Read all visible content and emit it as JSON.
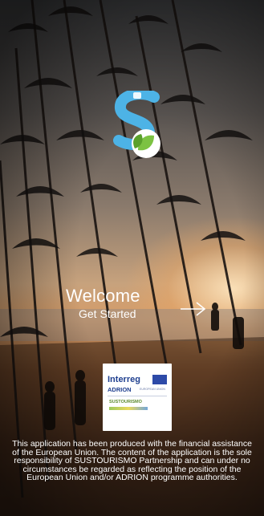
{
  "welcome": {
    "title": "Welcome",
    "subtitle": "Get Started",
    "next_icon": "arrow-right-icon"
  },
  "brand": {
    "logo_icon": "sustourismo-s-leaf-icon",
    "accent_blue": "#4db3e6",
    "accent_green": "#7cc242"
  },
  "partner_logo": {
    "interreg": "Interreg",
    "adrion": "ADRION",
    "adrion_sub": "EUROPEAN UNION",
    "project": "SUSTOURISMO"
  },
  "disclaimer": "This application has been produced with the financial assistance of the European Union. The content of the application is the sole responsibility of SUSTOURISMO Partnership and can under no circumstances be regarded as reflecting the position of the European Union and/or ADRION programme authorities."
}
